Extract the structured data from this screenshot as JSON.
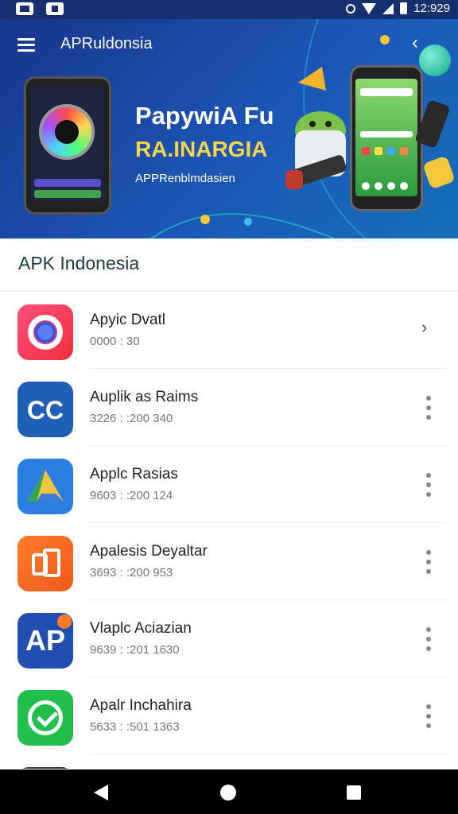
{
  "status_bar": {
    "time": "12:929"
  },
  "app_bar": {
    "title": "APRuldonsia"
  },
  "banner": {
    "title": "PapywiA Fu",
    "subtitle": "RA.INARGIA",
    "caption": "APPRenblmdasien"
  },
  "section": {
    "title": "APK Indonesia"
  },
  "list": {
    "items": [
      {
        "name": "Apyic Dvatl",
        "meta": "0000 : 30"
      },
      {
        "name": "Auplik as Raims",
        "meta": "3226 : :200 340"
      },
      {
        "name": "Applc Rasias",
        "meta": "9603 : :200 124"
      },
      {
        "name": "Apalesis Deyaltar",
        "meta": "3693 : :200 953"
      },
      {
        "name": "Vlaplc Aciazian",
        "meta": "9639 : :201 1630"
      },
      {
        "name": "Apalr Inchahira",
        "meta": "5633 : :501 1363"
      }
    ]
  },
  "icons": {
    "item1": "chrome-like-icon",
    "item2": "cc-icon",
    "item3": "drive-icon",
    "item4": "office-icon",
    "item5": "ap-icon",
    "item6": "whatsapp-icon"
  },
  "colors": {
    "header": "#1a4aa8",
    "accent_yellow": "#f6d64a",
    "android_green": "#7cc24a"
  }
}
